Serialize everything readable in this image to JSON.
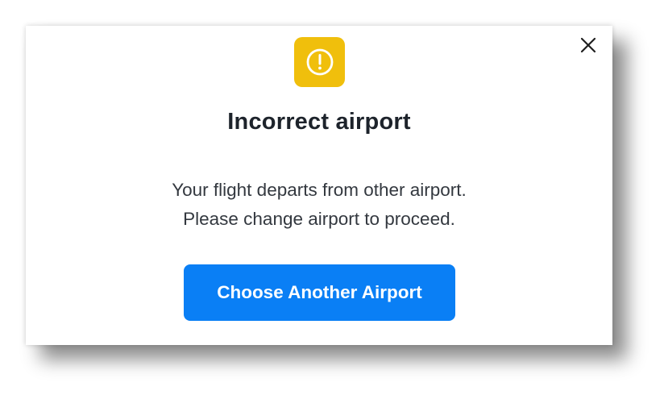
{
  "dialog": {
    "close_icon": "close-icon",
    "warning_icon": "exclamation-circle-icon",
    "title": "Incorrect airport",
    "message_lines": [
      "Your flight departs from other airport.",
      "Please change airport to proceed."
    ],
    "primary_button_label": "Choose Another Airport"
  },
  "colors": {
    "warning_badge": "#f0bf0c",
    "primary_button": "#0a7ff5",
    "title_text": "#1d232b",
    "body_text": "#33383f"
  }
}
